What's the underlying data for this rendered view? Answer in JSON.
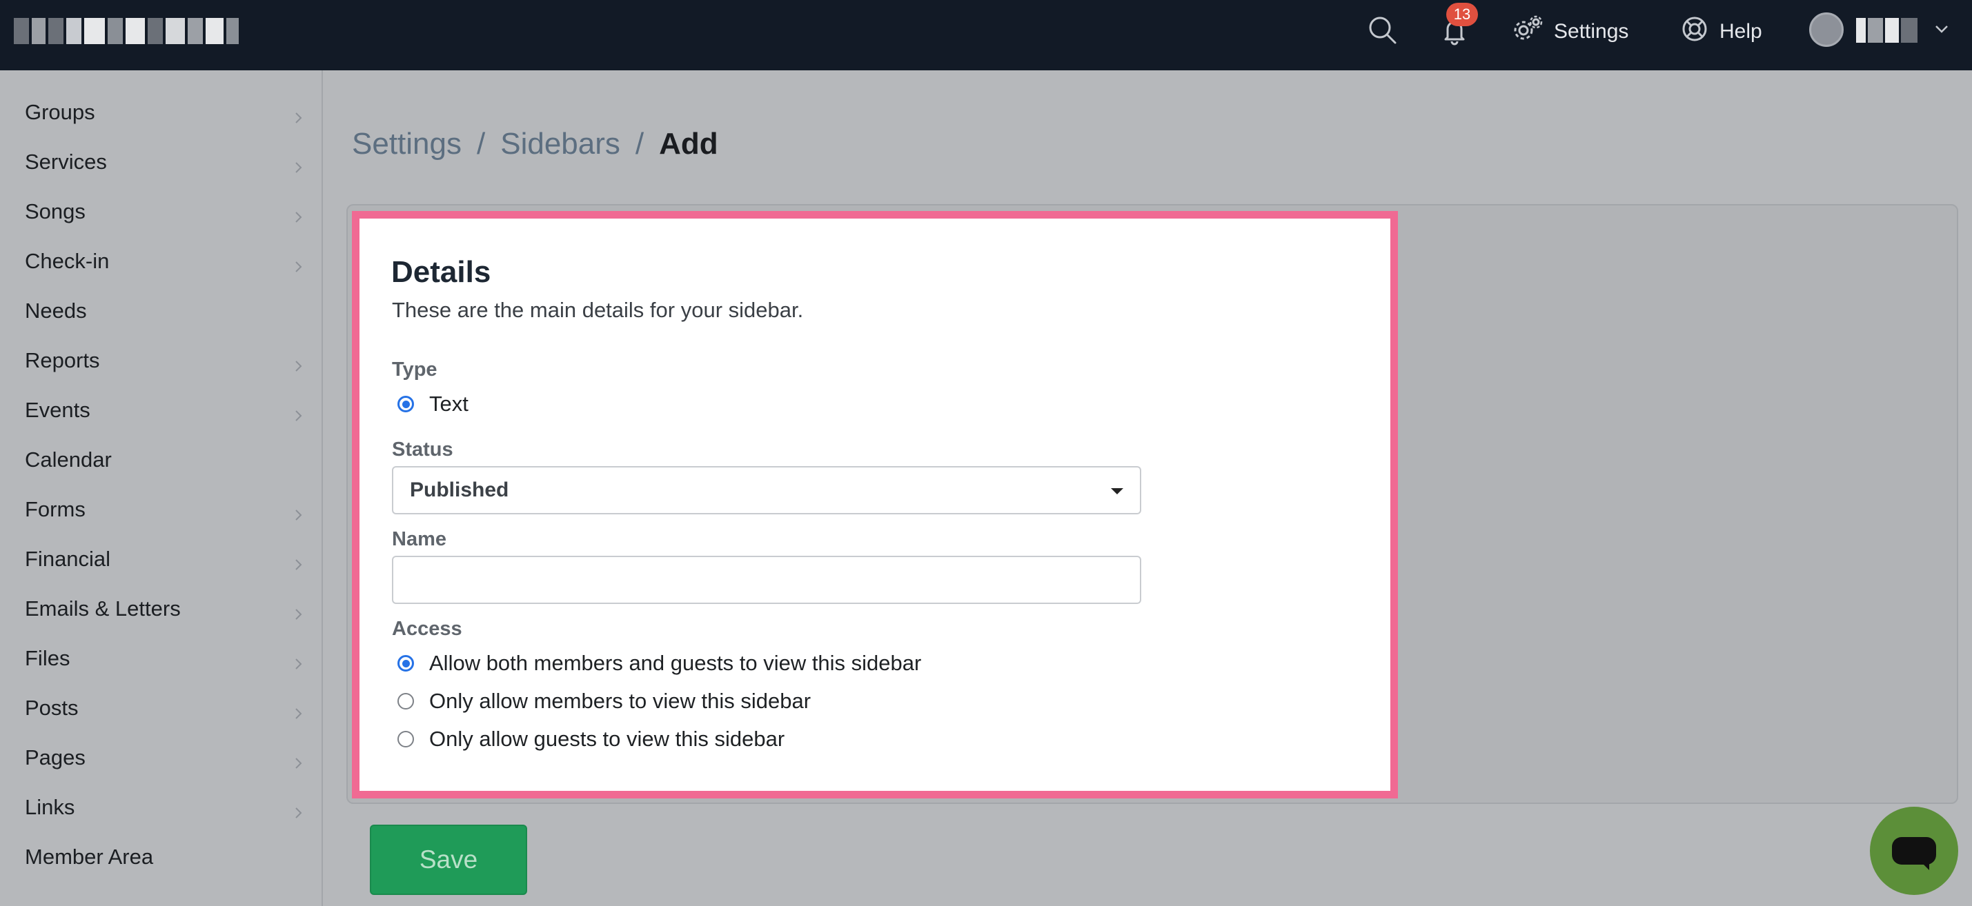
{
  "topbar": {
    "notification_count": "13",
    "settings_label": "Settings",
    "help_label": "Help"
  },
  "sidebar": {
    "items": [
      {
        "label": "Groups"
      },
      {
        "label": "Services"
      },
      {
        "label": "Songs"
      },
      {
        "label": "Check-in"
      },
      {
        "label": "Needs"
      },
      {
        "label": "Reports"
      },
      {
        "label": "Events"
      },
      {
        "label": "Calendar"
      },
      {
        "label": "Forms"
      },
      {
        "label": "Financial"
      },
      {
        "label": "Emails & Letters"
      },
      {
        "label": "Files"
      },
      {
        "label": "Posts"
      },
      {
        "label": "Pages"
      },
      {
        "label": "Links"
      },
      {
        "label": "Member Area"
      }
    ]
  },
  "breadcrumb": {
    "items": [
      "Settings",
      "Sidebars"
    ],
    "separator": "/",
    "current": "Add"
  },
  "form": {
    "title": "Details",
    "subtitle": "These are the main details for your sidebar.",
    "type_label": "Type",
    "type_option": "Text",
    "status_label": "Status",
    "status_value": "Published",
    "name_label": "Name",
    "name_value": "",
    "access_label": "Access",
    "access_options": [
      "Allow both members and guests to view this sidebar",
      "Only allow members to view this sidebar",
      "Only allow guests to view this sidebar"
    ]
  },
  "actions": {
    "save_label": "Save"
  },
  "colors": {
    "highlight_border": "#f06a93",
    "save_button": "#1f9b58",
    "topbar": "#121a26",
    "badge": "#e0503f",
    "radio_selected": "#2672e6",
    "chat_button": "#5c8f39"
  },
  "icons": {
    "search": "search-icon",
    "notifications": "bell-icon",
    "settings": "gear-icon",
    "help": "lifebuoy-icon",
    "chat": "chat-icon"
  }
}
